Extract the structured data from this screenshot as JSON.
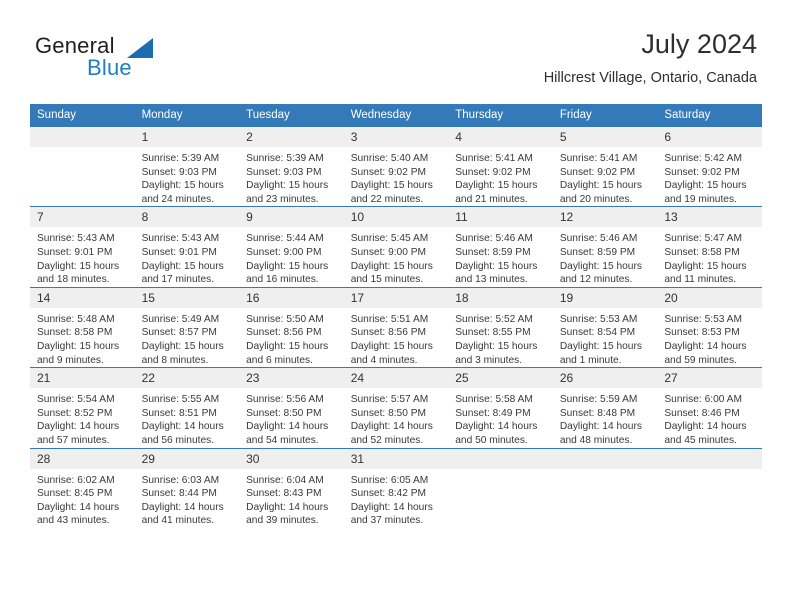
{
  "brand": {
    "name_part1": "General",
    "name_part2": "Blue",
    "logo_icon": "triangle-logo",
    "color_dark": "#231f20",
    "color_blue": "#1f7fc4"
  },
  "header": {
    "title": "July 2024",
    "subtitle": "Hillcrest Village, Ontario, Canada"
  },
  "theme": {
    "header_row_bg": "#3479b8",
    "header_row_text": "#ffffff",
    "daynum_bg": "#efefef",
    "row_alt_bg": "#f7f7f7",
    "grid_line": "#3479b8"
  },
  "weekday_headers": [
    "Sunday",
    "Monday",
    "Tuesday",
    "Wednesday",
    "Thursday",
    "Friday",
    "Saturday"
  ],
  "labels": {
    "sunrise_prefix": "Sunrise:",
    "sunset_prefix": "Sunset:",
    "daylight_prefix": "Daylight:"
  },
  "weeks": [
    [
      {
        "day": "",
        "sunrise": "",
        "sunset": "",
        "daylight_line1": "",
        "daylight_line2": ""
      },
      {
        "day": "1",
        "sunrise": "Sunrise: 5:39 AM",
        "sunset": "Sunset: 9:03 PM",
        "daylight_line1": "Daylight: 15 hours",
        "daylight_line2": "and 24 minutes."
      },
      {
        "day": "2",
        "sunrise": "Sunrise: 5:39 AM",
        "sunset": "Sunset: 9:03 PM",
        "daylight_line1": "Daylight: 15 hours",
        "daylight_line2": "and 23 minutes."
      },
      {
        "day": "3",
        "sunrise": "Sunrise: 5:40 AM",
        "sunset": "Sunset: 9:02 PM",
        "daylight_line1": "Daylight: 15 hours",
        "daylight_line2": "and 22 minutes."
      },
      {
        "day": "4",
        "sunrise": "Sunrise: 5:41 AM",
        "sunset": "Sunset: 9:02 PM",
        "daylight_line1": "Daylight: 15 hours",
        "daylight_line2": "and 21 minutes."
      },
      {
        "day": "5",
        "sunrise": "Sunrise: 5:41 AM",
        "sunset": "Sunset: 9:02 PM",
        "daylight_line1": "Daylight: 15 hours",
        "daylight_line2": "and 20 minutes."
      },
      {
        "day": "6",
        "sunrise": "Sunrise: 5:42 AM",
        "sunset": "Sunset: 9:02 PM",
        "daylight_line1": "Daylight: 15 hours",
        "daylight_line2": "and 19 minutes."
      }
    ],
    [
      {
        "day": "7",
        "sunrise": "Sunrise: 5:43 AM",
        "sunset": "Sunset: 9:01 PM",
        "daylight_line1": "Daylight: 15 hours",
        "daylight_line2": "and 18 minutes."
      },
      {
        "day": "8",
        "sunrise": "Sunrise: 5:43 AM",
        "sunset": "Sunset: 9:01 PM",
        "daylight_line1": "Daylight: 15 hours",
        "daylight_line2": "and 17 minutes."
      },
      {
        "day": "9",
        "sunrise": "Sunrise: 5:44 AM",
        "sunset": "Sunset: 9:00 PM",
        "daylight_line1": "Daylight: 15 hours",
        "daylight_line2": "and 16 minutes."
      },
      {
        "day": "10",
        "sunrise": "Sunrise: 5:45 AM",
        "sunset": "Sunset: 9:00 PM",
        "daylight_line1": "Daylight: 15 hours",
        "daylight_line2": "and 15 minutes."
      },
      {
        "day": "11",
        "sunrise": "Sunrise: 5:46 AM",
        "sunset": "Sunset: 8:59 PM",
        "daylight_line1": "Daylight: 15 hours",
        "daylight_line2": "and 13 minutes."
      },
      {
        "day": "12",
        "sunrise": "Sunrise: 5:46 AM",
        "sunset": "Sunset: 8:59 PM",
        "daylight_line1": "Daylight: 15 hours",
        "daylight_line2": "and 12 minutes."
      },
      {
        "day": "13",
        "sunrise": "Sunrise: 5:47 AM",
        "sunset": "Sunset: 8:58 PM",
        "daylight_line1": "Daylight: 15 hours",
        "daylight_line2": "and 11 minutes."
      }
    ],
    [
      {
        "day": "14",
        "sunrise": "Sunrise: 5:48 AM",
        "sunset": "Sunset: 8:58 PM",
        "daylight_line1": "Daylight: 15 hours",
        "daylight_line2": "and 9 minutes."
      },
      {
        "day": "15",
        "sunrise": "Sunrise: 5:49 AM",
        "sunset": "Sunset: 8:57 PM",
        "daylight_line1": "Daylight: 15 hours",
        "daylight_line2": "and 8 minutes."
      },
      {
        "day": "16",
        "sunrise": "Sunrise: 5:50 AM",
        "sunset": "Sunset: 8:56 PM",
        "daylight_line1": "Daylight: 15 hours",
        "daylight_line2": "and 6 minutes."
      },
      {
        "day": "17",
        "sunrise": "Sunrise: 5:51 AM",
        "sunset": "Sunset: 8:56 PM",
        "daylight_line1": "Daylight: 15 hours",
        "daylight_line2": "and 4 minutes."
      },
      {
        "day": "18",
        "sunrise": "Sunrise: 5:52 AM",
        "sunset": "Sunset: 8:55 PM",
        "daylight_line1": "Daylight: 15 hours",
        "daylight_line2": "and 3 minutes."
      },
      {
        "day": "19",
        "sunrise": "Sunrise: 5:53 AM",
        "sunset": "Sunset: 8:54 PM",
        "daylight_line1": "Daylight: 15 hours",
        "daylight_line2": "and 1 minute."
      },
      {
        "day": "20",
        "sunrise": "Sunrise: 5:53 AM",
        "sunset": "Sunset: 8:53 PM",
        "daylight_line1": "Daylight: 14 hours",
        "daylight_line2": "and 59 minutes."
      }
    ],
    [
      {
        "day": "21",
        "sunrise": "Sunrise: 5:54 AM",
        "sunset": "Sunset: 8:52 PM",
        "daylight_line1": "Daylight: 14 hours",
        "daylight_line2": "and 57 minutes."
      },
      {
        "day": "22",
        "sunrise": "Sunrise: 5:55 AM",
        "sunset": "Sunset: 8:51 PM",
        "daylight_line1": "Daylight: 14 hours",
        "daylight_line2": "and 56 minutes."
      },
      {
        "day": "23",
        "sunrise": "Sunrise: 5:56 AM",
        "sunset": "Sunset: 8:50 PM",
        "daylight_line1": "Daylight: 14 hours",
        "daylight_line2": "and 54 minutes."
      },
      {
        "day": "24",
        "sunrise": "Sunrise: 5:57 AM",
        "sunset": "Sunset: 8:50 PM",
        "daylight_line1": "Daylight: 14 hours",
        "daylight_line2": "and 52 minutes."
      },
      {
        "day": "25",
        "sunrise": "Sunrise: 5:58 AM",
        "sunset": "Sunset: 8:49 PM",
        "daylight_line1": "Daylight: 14 hours",
        "daylight_line2": "and 50 minutes."
      },
      {
        "day": "26",
        "sunrise": "Sunrise: 5:59 AM",
        "sunset": "Sunset: 8:48 PM",
        "daylight_line1": "Daylight: 14 hours",
        "daylight_line2": "and 48 minutes."
      },
      {
        "day": "27",
        "sunrise": "Sunrise: 6:00 AM",
        "sunset": "Sunset: 8:46 PM",
        "daylight_line1": "Daylight: 14 hours",
        "daylight_line2": "and 45 minutes."
      }
    ],
    [
      {
        "day": "28",
        "sunrise": "Sunrise: 6:02 AM",
        "sunset": "Sunset: 8:45 PM",
        "daylight_line1": "Daylight: 14 hours",
        "daylight_line2": "and 43 minutes."
      },
      {
        "day": "29",
        "sunrise": "Sunrise: 6:03 AM",
        "sunset": "Sunset: 8:44 PM",
        "daylight_line1": "Daylight: 14 hours",
        "daylight_line2": "and 41 minutes."
      },
      {
        "day": "30",
        "sunrise": "Sunrise: 6:04 AM",
        "sunset": "Sunset: 8:43 PM",
        "daylight_line1": "Daylight: 14 hours",
        "daylight_line2": "and 39 minutes."
      },
      {
        "day": "31",
        "sunrise": "Sunrise: 6:05 AM",
        "sunset": "Sunset: 8:42 PM",
        "daylight_line1": "Daylight: 14 hours",
        "daylight_line2": "and 37 minutes."
      },
      {
        "day": "",
        "sunrise": "",
        "sunset": "",
        "daylight_line1": "",
        "daylight_line2": ""
      },
      {
        "day": "",
        "sunrise": "",
        "sunset": "",
        "daylight_line1": "",
        "daylight_line2": ""
      },
      {
        "day": "",
        "sunrise": "",
        "sunset": "",
        "daylight_line1": "",
        "daylight_line2": ""
      }
    ]
  ]
}
